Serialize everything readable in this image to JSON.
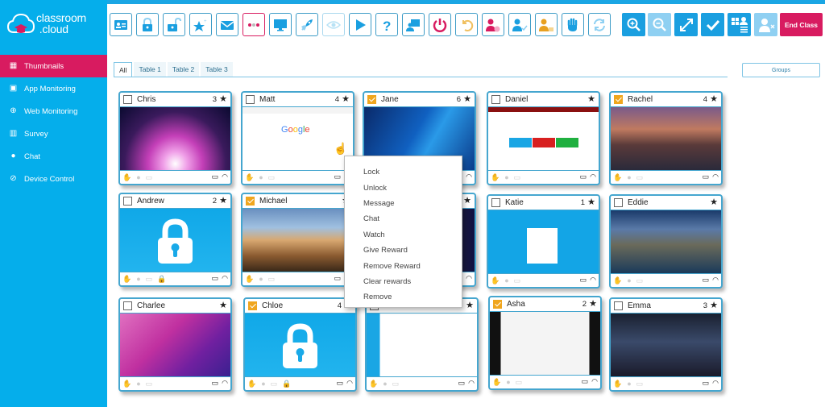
{
  "app": {
    "brand_line1": "classroom",
    "brand_line2": ".cloud"
  },
  "sidebar": {
    "items": [
      {
        "label": "Thumbnails",
        "icon": "grid-icon",
        "active": true
      },
      {
        "label": "App Monitoring",
        "icon": "window-icon",
        "active": false
      },
      {
        "label": "Web Monitoring",
        "icon": "globe-icon",
        "active": false
      },
      {
        "label": "Survey",
        "icon": "bar-chart-icon",
        "active": false
      },
      {
        "label": "Chat",
        "icon": "chat-bubbles-icon",
        "active": false
      },
      {
        "label": "Device Control",
        "icon": "block-icon",
        "active": false
      }
    ]
  },
  "toolbar": {
    "buttons": [
      {
        "name": "register-icon"
      },
      {
        "name": "lock-icon"
      },
      {
        "name": "unlock-icon"
      },
      {
        "name": "reward-star-icon"
      },
      {
        "name": "message-icon"
      },
      {
        "name": "more-options-icon"
      },
      {
        "name": "monitor-icon"
      },
      {
        "name": "launch-rocket-icon"
      },
      {
        "name": "watch-eye-icon"
      },
      {
        "name": "play-icon"
      },
      {
        "name": "help-icon"
      },
      {
        "name": "present-icon"
      },
      {
        "name": "power-icon"
      },
      {
        "name": "undo-icon"
      },
      {
        "name": "user-timer-icon"
      },
      {
        "name": "user-check-icon"
      },
      {
        "name": "user-lock-icon"
      },
      {
        "name": "raise-hand-icon"
      },
      {
        "name": "refresh-icon"
      }
    ],
    "right_buttons": [
      {
        "name": "zoom-in-icon"
      },
      {
        "name": "zoom-out-icon"
      },
      {
        "name": "fullscreen-icon"
      },
      {
        "name": "select-all-icon"
      },
      {
        "name": "layout-grid-list-icon"
      },
      {
        "name": "remove-user-icon"
      }
    ],
    "end_class_label": "End Class"
  },
  "tabs": [
    {
      "label": "All",
      "active": true
    },
    {
      "label": "Table 1",
      "active": false
    },
    {
      "label": "Table 2",
      "active": false
    },
    {
      "label": "Table 3",
      "active": false
    }
  ],
  "groups_label": "Groups",
  "students": [
    {
      "name": "Chris",
      "score": "3",
      "checked": false,
      "screen": "mac-aurora"
    },
    {
      "name": "Matt",
      "score": "4",
      "checked": false,
      "screen": "google"
    },
    {
      "name": "Jane",
      "score": "6",
      "checked": true,
      "screen": "windows"
    },
    {
      "name": "Daniel",
      "score": "",
      "checked": false,
      "screen": "app-red"
    },
    {
      "name": "Rachel",
      "score": "4",
      "checked": true,
      "screen": "sierra"
    },
    {
      "name": "Andrew",
      "score": "2",
      "checked": false,
      "screen": "locked"
    },
    {
      "name": "Michael",
      "score": "",
      "checked": true,
      "screen": "mojave"
    },
    {
      "name": "",
      "score": "",
      "checked": false,
      "screen": "dark-app"
    },
    {
      "name": "Katie",
      "score": "1",
      "checked": false,
      "screen": "login"
    },
    {
      "name": "Eddie",
      "score": "",
      "checked": false,
      "screen": "catalina"
    },
    {
      "name": "Charlee",
      "score": "",
      "checked": false,
      "screen": "monterey"
    },
    {
      "name": "Chloe",
      "score": "4",
      "checked": true,
      "screen": "locked"
    },
    {
      "name": "",
      "score": "",
      "checked": false,
      "screen": "classroom-app"
    },
    {
      "name": "Asha",
      "score": "2",
      "checked": true,
      "screen": "browser"
    },
    {
      "name": "Emma",
      "score": "3",
      "checked": false,
      "screen": "mojave-dark"
    }
  ],
  "context_menu": {
    "items": [
      "Lock",
      "Unlock",
      "Message",
      "Chat",
      "Watch",
      "Give Reward",
      "Remove Reward",
      "Clear rewards",
      "Remove"
    ]
  },
  "colors": {
    "accent": "#05aeeb",
    "active": "#d81b60",
    "checkbox": "#f0a61e",
    "border": "#45a6cf"
  }
}
